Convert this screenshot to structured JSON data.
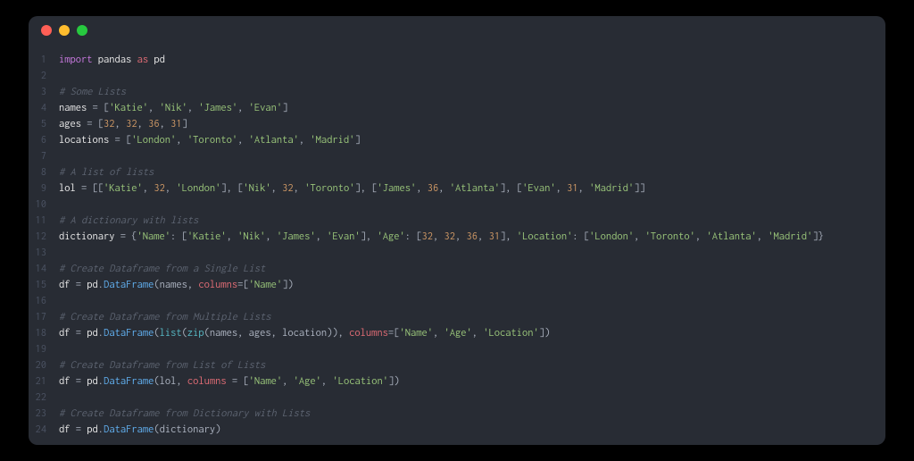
{
  "window": {
    "dots": [
      "red",
      "yellow",
      "green"
    ]
  },
  "code": {
    "lines": [
      {
        "num": "1",
        "tokens": [
          {
            "t": "import",
            "c": "kw"
          },
          {
            "t": " ",
            "c": ""
          },
          {
            "t": "pandas",
            "c": "white"
          },
          {
            "t": " ",
            "c": ""
          },
          {
            "t": "as",
            "c": "kw-as"
          },
          {
            "t": " ",
            "c": ""
          },
          {
            "t": "pd",
            "c": "white"
          }
        ]
      },
      {
        "num": "2",
        "tokens": []
      },
      {
        "num": "3",
        "tokens": [
          {
            "t": "# Some Lists",
            "c": "comment"
          }
        ]
      },
      {
        "num": "4",
        "tokens": [
          {
            "t": "names ",
            "c": "white"
          },
          {
            "t": "= [",
            "c": "op"
          },
          {
            "t": "'Katie'",
            "c": "str"
          },
          {
            "t": ", ",
            "c": "op"
          },
          {
            "t": "'Nik'",
            "c": "str"
          },
          {
            "t": ", ",
            "c": "op"
          },
          {
            "t": "'James'",
            "c": "str"
          },
          {
            "t": ", ",
            "c": "op"
          },
          {
            "t": "'Evan'",
            "c": "str"
          },
          {
            "t": "]",
            "c": "op"
          }
        ]
      },
      {
        "num": "5",
        "tokens": [
          {
            "t": "ages ",
            "c": "white"
          },
          {
            "t": "= [",
            "c": "op"
          },
          {
            "t": "32",
            "c": "num"
          },
          {
            "t": ", ",
            "c": "op"
          },
          {
            "t": "32",
            "c": "num"
          },
          {
            "t": ", ",
            "c": "op"
          },
          {
            "t": "36",
            "c": "num"
          },
          {
            "t": ", ",
            "c": "op"
          },
          {
            "t": "31",
            "c": "num"
          },
          {
            "t": "]",
            "c": "op"
          }
        ]
      },
      {
        "num": "6",
        "tokens": [
          {
            "t": "locations ",
            "c": "white"
          },
          {
            "t": "= [",
            "c": "op"
          },
          {
            "t": "'London'",
            "c": "str"
          },
          {
            "t": ", ",
            "c": "op"
          },
          {
            "t": "'Toronto'",
            "c": "str"
          },
          {
            "t": ", ",
            "c": "op"
          },
          {
            "t": "'Atlanta'",
            "c": "str"
          },
          {
            "t": ", ",
            "c": "op"
          },
          {
            "t": "'Madrid'",
            "c": "str"
          },
          {
            "t": "]",
            "c": "op"
          }
        ]
      },
      {
        "num": "7",
        "tokens": []
      },
      {
        "num": "8",
        "tokens": [
          {
            "t": "# A list of lists",
            "c": "comment"
          }
        ]
      },
      {
        "num": "9",
        "tokens": [
          {
            "t": "lol ",
            "c": "white"
          },
          {
            "t": "= [[",
            "c": "op"
          },
          {
            "t": "'Katie'",
            "c": "str"
          },
          {
            "t": ", ",
            "c": "op"
          },
          {
            "t": "32",
            "c": "num"
          },
          {
            "t": ", ",
            "c": "op"
          },
          {
            "t": "'London'",
            "c": "str"
          },
          {
            "t": "], [",
            "c": "op"
          },
          {
            "t": "'Nik'",
            "c": "str"
          },
          {
            "t": ", ",
            "c": "op"
          },
          {
            "t": "32",
            "c": "num"
          },
          {
            "t": ", ",
            "c": "op"
          },
          {
            "t": "'Toronto'",
            "c": "str"
          },
          {
            "t": "], [",
            "c": "op"
          },
          {
            "t": "'James'",
            "c": "str"
          },
          {
            "t": ", ",
            "c": "op"
          },
          {
            "t": "36",
            "c": "num"
          },
          {
            "t": ", ",
            "c": "op"
          },
          {
            "t": "'Atlanta'",
            "c": "str"
          },
          {
            "t": "], [",
            "c": "op"
          },
          {
            "t": "'Evan'",
            "c": "str"
          },
          {
            "t": ", ",
            "c": "op"
          },
          {
            "t": "31",
            "c": "num"
          },
          {
            "t": ", ",
            "c": "op"
          },
          {
            "t": "'Madrid'",
            "c": "str"
          },
          {
            "t": "]]",
            "c": "op"
          }
        ]
      },
      {
        "num": "10",
        "tokens": []
      },
      {
        "num": "11",
        "tokens": [
          {
            "t": "# A dictionary with lists",
            "c": "comment"
          }
        ]
      },
      {
        "num": "12",
        "tokens": [
          {
            "t": "dictionary ",
            "c": "white"
          },
          {
            "t": "= {",
            "c": "op"
          },
          {
            "t": "'Name'",
            "c": "str"
          },
          {
            "t": ": [",
            "c": "op"
          },
          {
            "t": "'Katie'",
            "c": "str"
          },
          {
            "t": ", ",
            "c": "op"
          },
          {
            "t": "'Nik'",
            "c": "str"
          },
          {
            "t": ", ",
            "c": "op"
          },
          {
            "t": "'James'",
            "c": "str"
          },
          {
            "t": ", ",
            "c": "op"
          },
          {
            "t": "'Evan'",
            "c": "str"
          },
          {
            "t": "], ",
            "c": "op"
          },
          {
            "t": "'Age'",
            "c": "str"
          },
          {
            "t": ": [",
            "c": "op"
          },
          {
            "t": "32",
            "c": "num"
          },
          {
            "t": ", ",
            "c": "op"
          },
          {
            "t": "32",
            "c": "num"
          },
          {
            "t": ", ",
            "c": "op"
          },
          {
            "t": "36",
            "c": "num"
          },
          {
            "t": ", ",
            "c": "op"
          },
          {
            "t": "31",
            "c": "num"
          },
          {
            "t": "], ",
            "c": "op"
          },
          {
            "t": "'Location'",
            "c": "str"
          },
          {
            "t": ": [",
            "c": "op"
          },
          {
            "t": "'London'",
            "c": "str"
          },
          {
            "t": ", ",
            "c": "op"
          },
          {
            "t": "'Toronto'",
            "c": "str"
          },
          {
            "t": ", ",
            "c": "op"
          },
          {
            "t": "'Atlanta'",
            "c": "str"
          },
          {
            "t": ", ",
            "c": "op"
          },
          {
            "t": "'Madrid'",
            "c": "str"
          },
          {
            "t": "]}",
            "c": "op"
          }
        ]
      },
      {
        "num": "13",
        "tokens": []
      },
      {
        "num": "14",
        "tokens": [
          {
            "t": "# Create Dataframe from a Single List",
            "c": "comment"
          }
        ]
      },
      {
        "num": "15",
        "tokens": [
          {
            "t": "df ",
            "c": "white"
          },
          {
            "t": "= ",
            "c": "op"
          },
          {
            "t": "pd",
            "c": "white"
          },
          {
            "t": ".",
            "c": "op"
          },
          {
            "t": "DataFrame",
            "c": "func"
          },
          {
            "t": "(names, ",
            "c": "op"
          },
          {
            "t": "columns",
            "c": "param"
          },
          {
            "t": "=[",
            "c": "op"
          },
          {
            "t": "'Name'",
            "c": "str"
          },
          {
            "t": "])",
            "c": "op"
          }
        ]
      },
      {
        "num": "16",
        "tokens": []
      },
      {
        "num": "17",
        "tokens": [
          {
            "t": "# Create Dataframe from Multiple Lists",
            "c": "comment"
          }
        ]
      },
      {
        "num": "18",
        "tokens": [
          {
            "t": "df ",
            "c": "white"
          },
          {
            "t": "= ",
            "c": "op"
          },
          {
            "t": "pd",
            "c": "white"
          },
          {
            "t": ".",
            "c": "op"
          },
          {
            "t": "DataFrame",
            "c": "func"
          },
          {
            "t": "(",
            "c": "op"
          },
          {
            "t": "list",
            "c": "builtin"
          },
          {
            "t": "(",
            "c": "op"
          },
          {
            "t": "zip",
            "c": "builtin"
          },
          {
            "t": "(names, ages, location)), ",
            "c": "op"
          },
          {
            "t": "columns",
            "c": "param"
          },
          {
            "t": "=[",
            "c": "op"
          },
          {
            "t": "'Name'",
            "c": "str"
          },
          {
            "t": ", ",
            "c": "op"
          },
          {
            "t": "'Age'",
            "c": "str"
          },
          {
            "t": ", ",
            "c": "op"
          },
          {
            "t": "'Location'",
            "c": "str"
          },
          {
            "t": "])",
            "c": "op"
          }
        ]
      },
      {
        "num": "19",
        "tokens": []
      },
      {
        "num": "20",
        "tokens": [
          {
            "t": "# Create Dataframe from List of Lists",
            "c": "comment"
          }
        ]
      },
      {
        "num": "21",
        "tokens": [
          {
            "t": "df ",
            "c": "white"
          },
          {
            "t": "= ",
            "c": "op"
          },
          {
            "t": "pd",
            "c": "white"
          },
          {
            "t": ".",
            "c": "op"
          },
          {
            "t": "DataFrame",
            "c": "func"
          },
          {
            "t": "(lol, ",
            "c": "op"
          },
          {
            "t": "columns",
            "c": "param"
          },
          {
            "t": " = [",
            "c": "op"
          },
          {
            "t": "'Name'",
            "c": "str"
          },
          {
            "t": ", ",
            "c": "op"
          },
          {
            "t": "'Age'",
            "c": "str"
          },
          {
            "t": ", ",
            "c": "op"
          },
          {
            "t": "'Location'",
            "c": "str"
          },
          {
            "t": "])",
            "c": "op"
          }
        ]
      },
      {
        "num": "22",
        "tokens": []
      },
      {
        "num": "23",
        "tokens": [
          {
            "t": "# Create Dataframe from Dictionary with Lists",
            "c": "comment"
          }
        ]
      },
      {
        "num": "24",
        "tokens": [
          {
            "t": "df ",
            "c": "white"
          },
          {
            "t": "= ",
            "c": "op"
          },
          {
            "t": "pd",
            "c": "white"
          },
          {
            "t": ".",
            "c": "op"
          },
          {
            "t": "DataFrame",
            "c": "func"
          },
          {
            "t": "(dictionary)",
            "c": "op"
          }
        ]
      }
    ]
  }
}
